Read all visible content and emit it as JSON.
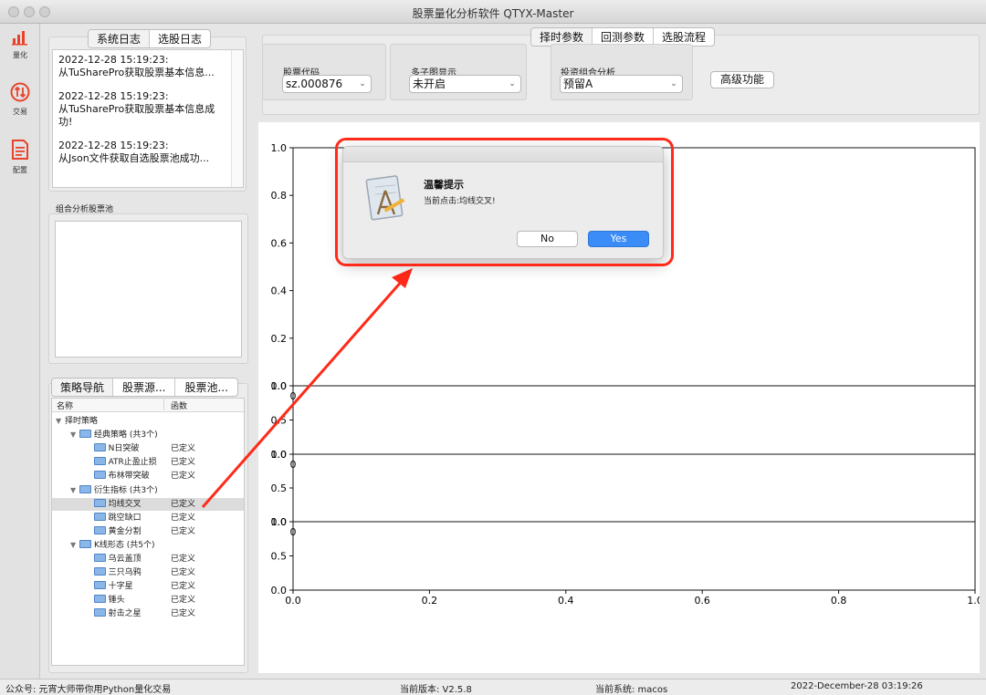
{
  "window": {
    "title": "股票量化分析软件 QTYX-Master"
  },
  "leftnav": [
    {
      "label": "量化",
      "icon": "bar-chart-icon"
    },
    {
      "label": "交易",
      "icon": "exchange-icon"
    },
    {
      "label": "配置",
      "icon": "document-icon"
    }
  ],
  "log": {
    "tabs": [
      "系统日志",
      "选股日志"
    ],
    "entries": [
      {
        "time": "2022-12-28 15:19:23:",
        "msg": "从TuSharePro获取股票基本信息..."
      },
      {
        "time": "2022-12-28 15:19:23:",
        "msg": "从TuSharePro获取股票基本信息成",
        "msg2": "功!"
      },
      {
        "time": "2022-12-28 15:19:23:",
        "msg": "从Json文件获取自选股票池成功..."
      }
    ]
  },
  "pool": {
    "label": "组合分析股票池"
  },
  "strategy": {
    "tabs": [
      "策略导航",
      "股票源...",
      "股票池..."
    ],
    "columns": [
      "名称",
      "函数"
    ],
    "root": "择时策略",
    "groups": [
      {
        "name": "经典策略 (共3个)",
        "items": [
          {
            "name": "N日突破",
            "fn": "已定义"
          },
          {
            "name": "ATR止盈止损",
            "fn": "已定义"
          },
          {
            "name": "布林带突破",
            "fn": "已定义"
          }
        ]
      },
      {
        "name": "衍生指标 (共3个)",
        "items": [
          {
            "name": "均线交叉",
            "fn": "已定义"
          },
          {
            "name": "跳空缺口",
            "fn": "已定义"
          },
          {
            "name": "黄金分割",
            "fn": "已定义"
          }
        ]
      },
      {
        "name": "K线形态 (共5个)",
        "items": [
          {
            "name": "乌云盖顶",
            "fn": "已定义"
          },
          {
            "name": "三只乌鸦",
            "fn": "已定义"
          },
          {
            "name": "十字星",
            "fn": "已定义"
          },
          {
            "name": "锤头",
            "fn": "已定义"
          },
          {
            "name": "射击之星",
            "fn": "已定义"
          }
        ]
      }
    ]
  },
  "controls": {
    "tabs": [
      "择时参数",
      "回测参数",
      "选股流程"
    ],
    "stock_code": {
      "label": "股票代码",
      "value": "sz.000876"
    },
    "subplots": {
      "label": "多子图显示",
      "value": "未开启"
    },
    "portfolio": {
      "label": "投资组合分析",
      "value": "预留A"
    },
    "advanced": "高级功能"
  },
  "chart_data": [
    {
      "type": "line",
      "yticks": [
        "1.0",
        "0.8",
        "0.6",
        "0.4",
        "0.2",
        "0.0"
      ],
      "xticks": [
        "0"
      ],
      "series": []
    },
    {
      "type": "line",
      "yticks": [
        "1.0",
        "0.5",
        "0.0"
      ],
      "xticks": [
        "0"
      ],
      "series": []
    },
    {
      "type": "line",
      "yticks": [
        "1.0",
        "0.5",
        "0.0"
      ],
      "xticks": [
        "0"
      ],
      "series": []
    },
    {
      "type": "line",
      "yticks": [
        "1.0",
        "0.5",
        "0.0"
      ],
      "xticks": [
        "0.0",
        "0.2",
        "0.4",
        "0.6",
        "0.8",
        "1.0"
      ],
      "series": []
    }
  ],
  "dialog": {
    "title": "温馨提示",
    "message": "当前点击:均线交叉!",
    "no": "No",
    "yes": "Yes"
  },
  "status": {
    "account": "公众号: 元宵大师带你用Python量化交易",
    "version": "当前版本: V2.5.8",
    "system": "当前系统: macos",
    "datetime": "2022-December-28 03:19:26"
  },
  "colors": {
    "accent": "#3b8cf7",
    "highlight": "#ff2a1a"
  }
}
